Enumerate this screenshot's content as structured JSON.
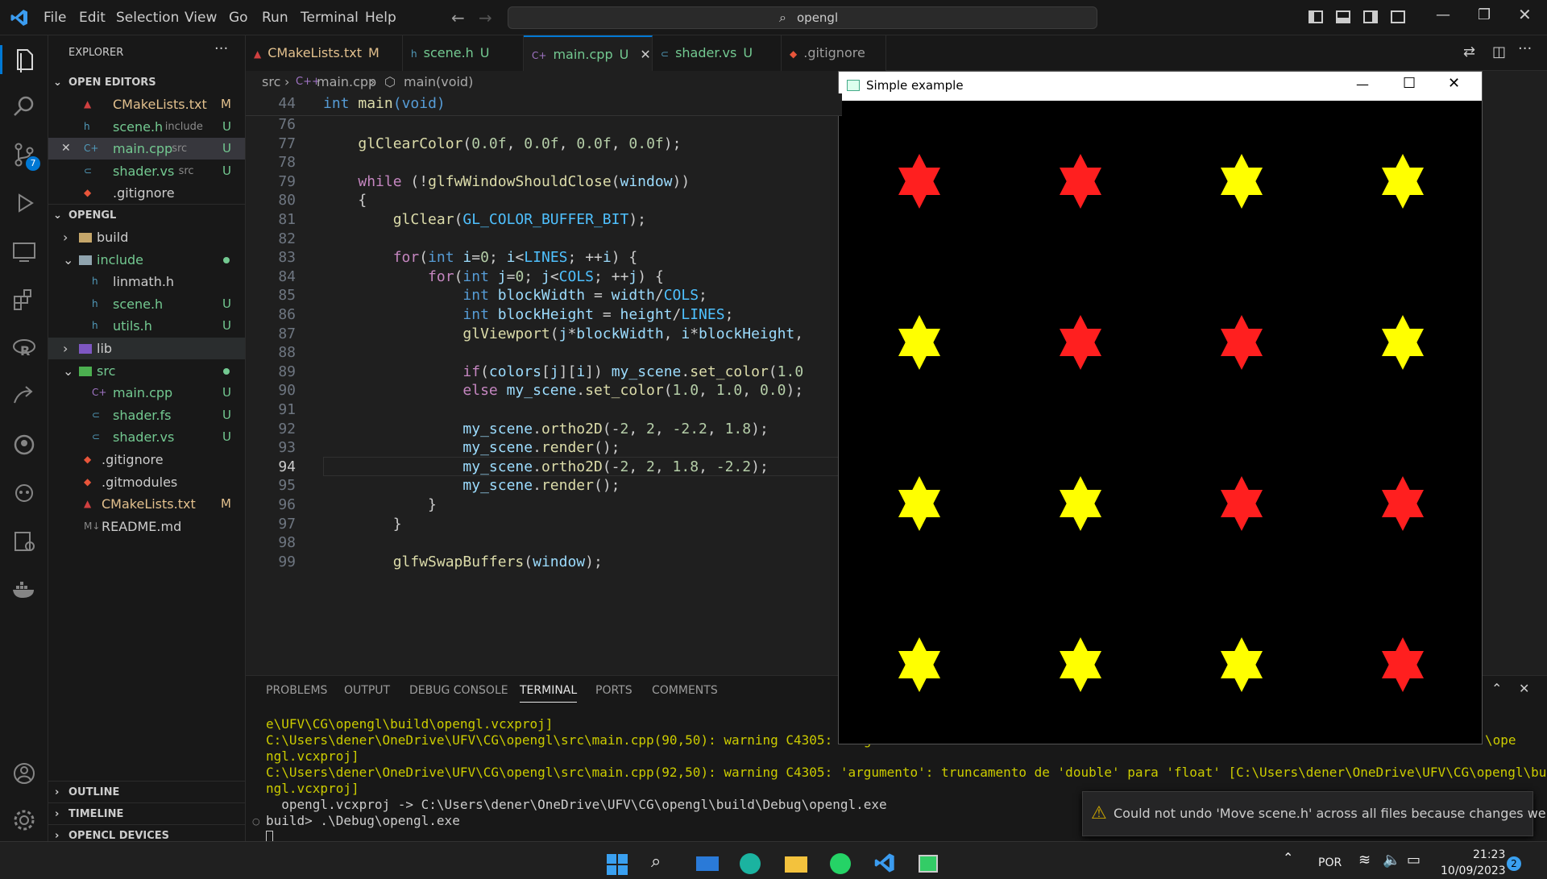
{
  "menu": [
    "File",
    "Edit",
    "Selection",
    "View",
    "Go",
    "Run",
    "Terminal",
    "Help"
  ],
  "search": {
    "text": "opengl"
  },
  "explorer": {
    "title": "EXPLORER",
    "open_editors_title": "OPEN EDITORS",
    "open_editors": [
      {
        "name": "CMakeLists.txt",
        "desc": "",
        "badge": "M",
        "color": "#e2c08d",
        "icon": "cmake-icon"
      },
      {
        "name": "scene.h",
        "desc": "include",
        "badge": "U",
        "color": "#73c991",
        "icon": "h-file-icon"
      },
      {
        "name": "main.cpp",
        "desc": "src",
        "badge": "U",
        "color": "#73c991",
        "icon": "cpp-file-icon"
      },
      {
        "name": "shader.vs",
        "desc": "src",
        "badge": "U",
        "color": "#73c991",
        "icon": "shader-file-icon"
      },
      {
        "name": ".gitignore",
        "desc": "",
        "badge": "",
        "color": "#cccccc",
        "icon": "git-icon"
      }
    ],
    "project_title": "OPENGL",
    "tree": [
      {
        "name": "build",
        "indent": 1,
        "type": "folder",
        "open": false,
        "badge": "",
        "color": "#cccccc"
      },
      {
        "name": "include",
        "indent": 1,
        "type": "folder",
        "open": true,
        "badge": "dot",
        "color": "#73c991"
      },
      {
        "name": "linmath.h",
        "indent": 2,
        "type": "file",
        "badge": "",
        "color": "#cccccc"
      },
      {
        "name": "scene.h",
        "indent": 2,
        "type": "file",
        "badge": "U",
        "color": "#73c991"
      },
      {
        "name": "utils.h",
        "indent": 2,
        "type": "file",
        "badge": "U",
        "color": "#73c991"
      },
      {
        "name": "lib",
        "indent": 1,
        "type": "folder",
        "open": false,
        "badge": "",
        "color": "#cccccc"
      },
      {
        "name": "src",
        "indent": 1,
        "type": "folder",
        "open": true,
        "badge": "dot",
        "color": "#73c991"
      },
      {
        "name": "main.cpp",
        "indent": 2,
        "type": "file",
        "badge": "U",
        "color": "#73c991"
      },
      {
        "name": "shader.fs",
        "indent": 2,
        "type": "file",
        "badge": "U",
        "color": "#73c991"
      },
      {
        "name": "shader.vs",
        "indent": 2,
        "type": "file",
        "badge": "U",
        "color": "#73c991"
      },
      {
        "name": ".gitignore",
        "indent": 1,
        "type": "file",
        "badge": "",
        "color": "#cccccc"
      },
      {
        "name": ".gitmodules",
        "indent": 1,
        "type": "file",
        "badge": "",
        "color": "#cccccc"
      },
      {
        "name": "CMakeLists.txt",
        "indent": 1,
        "type": "file",
        "badge": "M",
        "color": "#e2c08d"
      },
      {
        "name": "README.md",
        "indent": 1,
        "type": "file",
        "badge": "",
        "color": "#cccccc"
      }
    ],
    "outline": "OUTLINE",
    "timeline": "TIMELINE",
    "opencl": "OPENCL DEVICES"
  },
  "tabs": [
    {
      "name": "CMakeLists.txt",
      "badge": "M",
      "color": "#e2c08d",
      "active": false
    },
    {
      "name": "scene.h",
      "badge": "U",
      "color": "#73c991",
      "active": false
    },
    {
      "name": "main.cpp",
      "badge": "U",
      "color": "#73c991",
      "active": true
    },
    {
      "name": "shader.vs",
      "badge": "U",
      "color": "#73c991",
      "active": false
    },
    {
      "name": ".gitignore",
      "badge": "",
      "color": "#9d9d9d",
      "active": false
    }
  ],
  "breadcrumb": {
    "a": "src",
    "b": "main.cpp",
    "c": "main(void)"
  },
  "sticky": {
    "num": "44",
    "code": "int main(void)"
  },
  "code": [
    {
      "n": "76",
      "t": ""
    },
    {
      "n": "77",
      "t": "    glClearColor(0.0f, 0.0f, 0.0f, 0.0f);"
    },
    {
      "n": "78",
      "t": ""
    },
    {
      "n": "79",
      "t": "    while (!glfwWindowShouldClose(window))"
    },
    {
      "n": "80",
      "t": "    {"
    },
    {
      "n": "81",
      "t": "        glClear(GL_COLOR_BUFFER_BIT);"
    },
    {
      "n": "82",
      "t": ""
    },
    {
      "n": "83",
      "t": "        for(int i=0; i<LINES; ++i) {"
    },
    {
      "n": "84",
      "t": "            for(int j=0; j<COLS; ++j) {"
    },
    {
      "n": "85",
      "t": "                int blockWidth = width/COLS;"
    },
    {
      "n": "86",
      "t": "                int blockHeight = height/LINES;"
    },
    {
      "n": "87",
      "t": "                glViewport(j*blockWidth, i*blockHeight,"
    },
    {
      "n": "88",
      "t": ""
    },
    {
      "n": "89",
      "t": "                if(colors[j][i]) my_scene.set_color(1.0"
    },
    {
      "n": "90",
      "t": "                else my_scene.set_color(1.0, 1.0, 0.0);"
    },
    {
      "n": "91",
      "t": ""
    },
    {
      "n": "92",
      "t": "                my_scene.ortho2D(-2, 2, -2.2, 1.8);"
    },
    {
      "n": "93",
      "t": "                my_scene.render();"
    },
    {
      "n": "94",
      "t": "                my_scene.ortho2D(-2, 2, 1.8, -2.2);"
    },
    {
      "n": "95",
      "t": "                my_scene.render();"
    },
    {
      "n": "96",
      "t": "            }"
    },
    {
      "n": "97",
      "t": "        }"
    },
    {
      "n": "98",
      "t": ""
    },
    {
      "n": "99",
      "t": "        glfwSwapBuffers(window);"
    }
  ],
  "panel_tabs": [
    "PROBLEMS",
    "OUTPUT",
    "DEBUG CONSOLE",
    "TERMINAL",
    "PORTS",
    "COMMENTS"
  ],
  "terminal": [
    "e\\UFV\\CG\\opengl\\build\\opengl.vcxproj]",
    "C:\\Users\\dener\\OneDrive\\UFV\\CG\\opengl\\src\\main.cpp(90,50): warning C4305: 'argu",
    "ngl.vcxproj]",
    "C:\\Users\\dener\\OneDrive\\UFV\\CG\\opengl\\src\\main.cpp(92,50): warning C4305: 'argumento': truncamento de 'double' para 'float' [C:\\Users\\dener\\OneDrive\\UFV\\CG\\opengl\\build\\ope",
    "ngl.vcxproj]",
    "  opengl.vcxproj -> C:\\Users\\dener\\OneDrive\\UFV\\CG\\opengl\\build\\Debug\\opengl.exe",
    "build> .\\Debug\\opengl.exe"
  ],
  "terminal_tail_90": "\\ope",
  "popup": {
    "title": "Simple example",
    "stars": [
      [
        "red",
        "red",
        "yellow",
        "yellow"
      ],
      [
        "yellow",
        "red",
        "red",
        "yellow"
      ],
      [
        "yellow",
        "yellow",
        "red",
        "red"
      ],
      [
        "yellow",
        "yellow",
        "yellow",
        "red"
      ]
    ]
  },
  "notification": "Could not undo 'Move scene.h' across all files because changes were ...",
  "taskbar": {
    "lang": "POR",
    "time": "21:23",
    "date": "10/09/2023",
    "notif_count": "2"
  },
  "scm_badge": "7"
}
